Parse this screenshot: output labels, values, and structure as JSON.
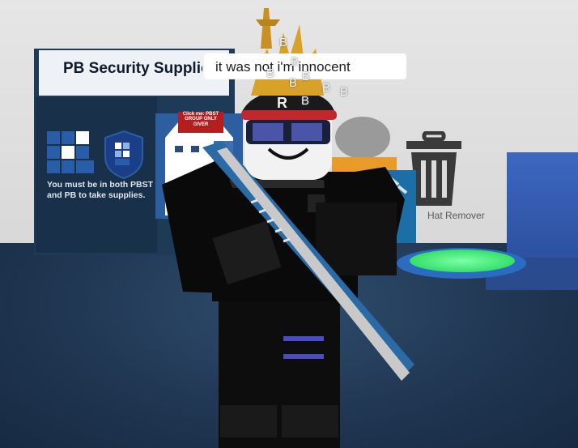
{
  "kiosk": {
    "title": "PB Security Supplies",
    "note": "You must be in both PBST and PB to take supplies.",
    "group_tag": "Click me: PBST GROUP ONLY GIVER"
  },
  "hat_remover": {
    "label": "Hat Remover",
    "icon": "trash-icon"
  },
  "chat": {
    "message": "it was not i'm innocent"
  },
  "floating_glyphs": [
    "B",
    "B",
    "B",
    "B",
    "B",
    "B",
    "B",
    "B"
  ],
  "colors": {
    "floor": "#1f3550",
    "pad_glow": "#36e06a",
    "kiosk": "#1d3a56",
    "bubble": "#ffffff"
  }
}
